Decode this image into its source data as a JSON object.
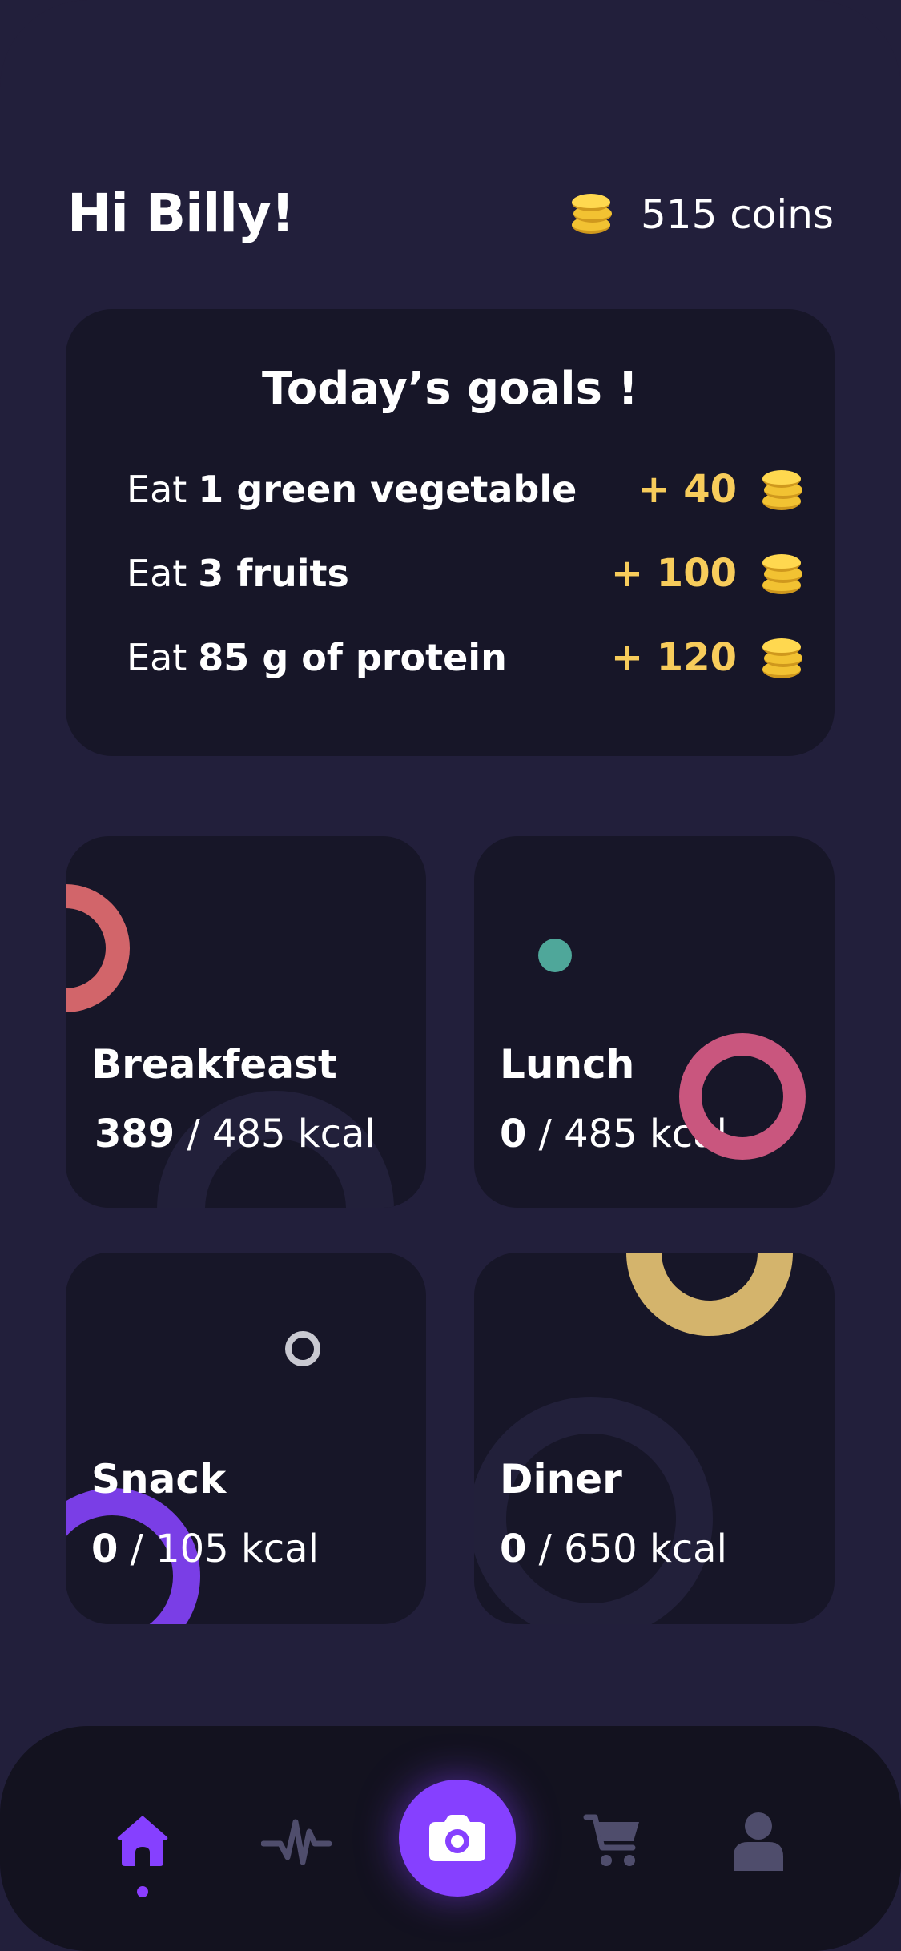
{
  "header": {
    "greeting": "Hi Billy!",
    "coins_label": "515 coins",
    "coin_icon": "coin-stack-icon"
  },
  "goals": {
    "title": "Today’s goals !",
    "items": [
      {
        "prefix": "Eat",
        "highlight": "1 green vegetable",
        "suffix": "",
        "reward": "+ 40"
      },
      {
        "prefix": "Eat",
        "highlight": "3 fruits",
        "suffix": "",
        "reward": "+ 100"
      },
      {
        "prefix": "Eat",
        "highlight": "85 g of protein",
        "suffix": "",
        "reward": "+ 120"
      }
    ]
  },
  "meals": [
    {
      "name": "Breakfeast",
      "consumed": "389",
      "target": "/ 485 kcal"
    },
    {
      "name": "Lunch",
      "consumed": "0",
      "target": "/ 485 kcal"
    },
    {
      "name": "Snack",
      "consumed": "0",
      "target": "/ 105 kcal"
    },
    {
      "name": "Diner",
      "consumed": "0",
      "target": "/ 650 kcal"
    }
  ],
  "nav": {
    "items": [
      "home-icon",
      "activity-icon",
      "camera-icon",
      "cart-icon",
      "profile-icon"
    ],
    "active": "home-icon"
  },
  "colors": {
    "background": "#221f3b",
    "card": "#171628",
    "accent": "#8640ff",
    "reward": "#f7cc5b",
    "coin": "#f2c232",
    "nav_inactive": "#4f4d6c"
  }
}
